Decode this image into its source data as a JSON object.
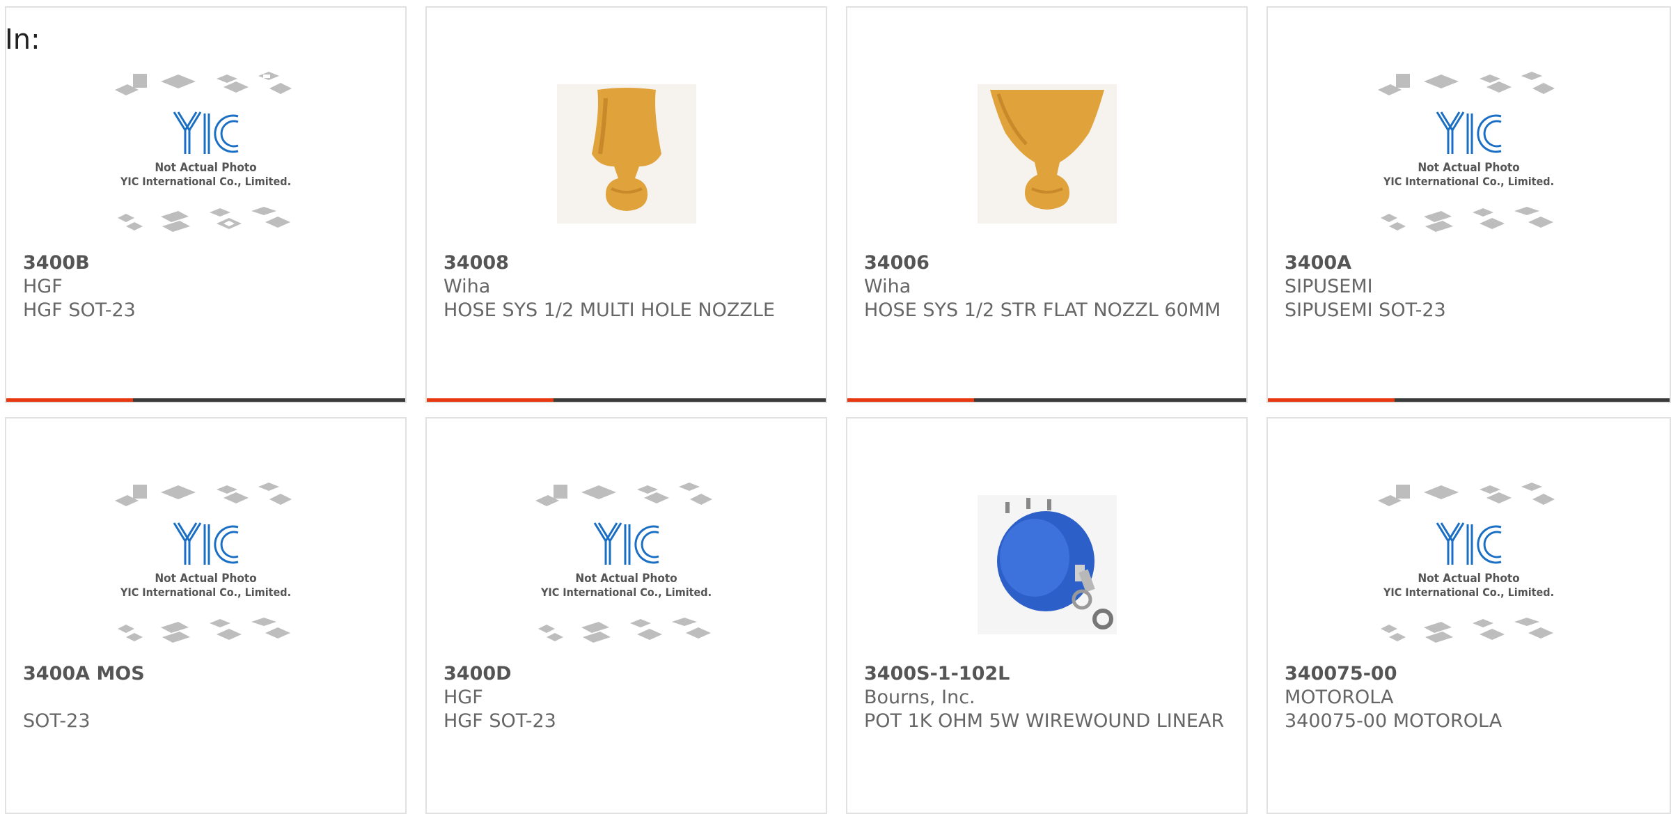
{
  "header": {
    "in_label": "In:"
  },
  "placeholder": {
    "line1": "Not Actual Photo",
    "line2": "YIC International Co., Limited.",
    "logo_text": "YIC"
  },
  "colors": {
    "accent": "#e8380f",
    "bar_dark": "#3a3a3a",
    "yic_blue": "#1a6fc4",
    "nozzle": "#e0a23a",
    "pot_blue": "#2d5fc8"
  },
  "products": [
    {
      "part": "3400B",
      "maker": "HGF",
      "desc": "HGF SOT-23",
      "image": "yic-placeholder"
    },
    {
      "part": "34008",
      "maker": "Wiha",
      "desc": "HOSE SYS 1/2 MULTI HOLE NOZZLE",
      "image": "nozzle-round"
    },
    {
      "part": "34006",
      "maker": "Wiha",
      "desc": "HOSE SYS 1/2 STR FLAT NOZZL 60MM",
      "image": "nozzle-flat"
    },
    {
      "part": "3400A",
      "maker": "SIPUSEMI",
      "desc": "SIPUSEMI SOT-23",
      "image": "yic-placeholder"
    },
    {
      "part": "3400A MOS",
      "maker": "",
      "desc": "SOT-23",
      "image": "yic-placeholder"
    },
    {
      "part": "3400D",
      "maker": "HGF",
      "desc": "HGF SOT-23",
      "image": "yic-placeholder"
    },
    {
      "part": "3400S-1-102L",
      "maker": "Bourns, Inc.",
      "desc": "POT 1K OHM 5W WIREWOUND LINEAR",
      "image": "potentiometer"
    },
    {
      "part": "340075-00",
      "maker": "MOTOROLA",
      "desc": "340075-00 MOTOROLA",
      "image": "yic-placeholder"
    }
  ]
}
